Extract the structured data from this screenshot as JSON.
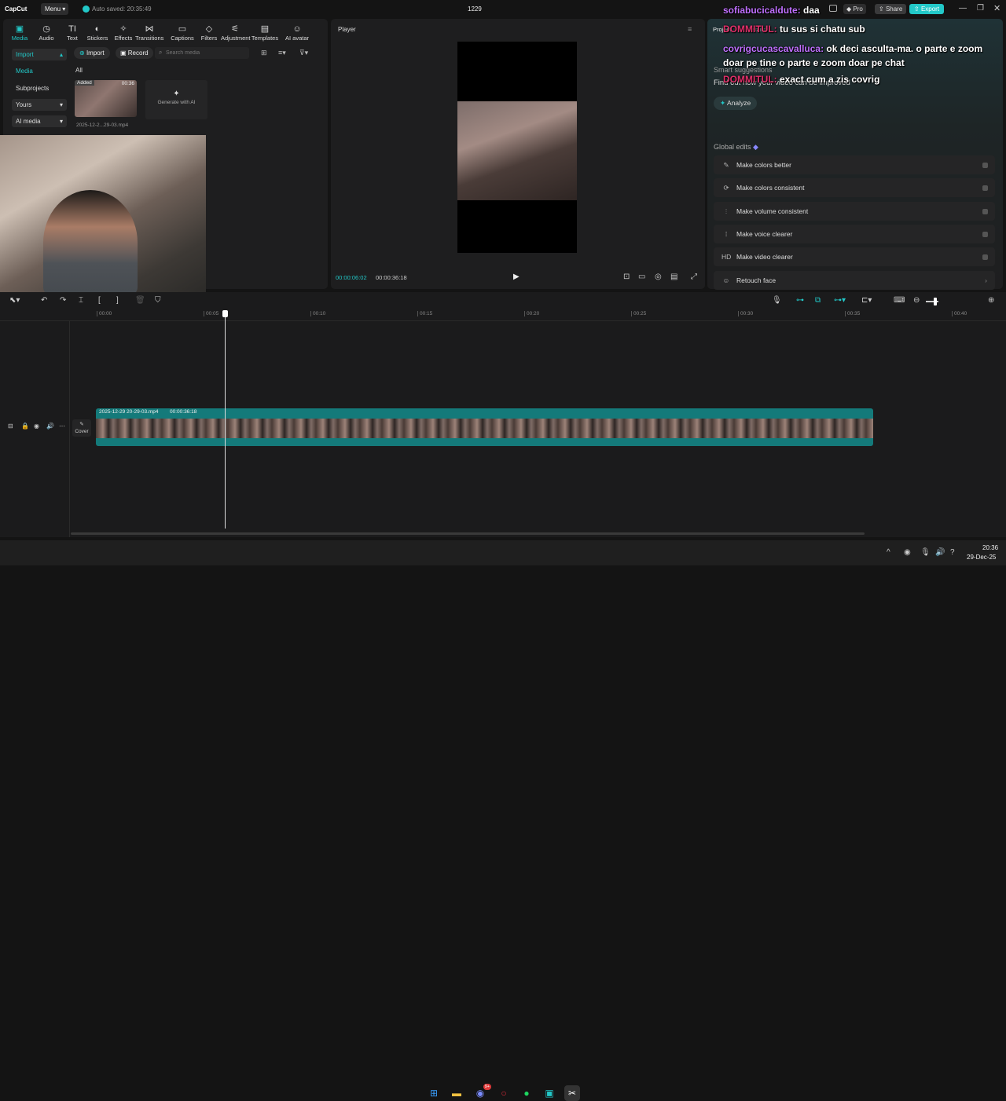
{
  "app": {
    "logo": "CapCut",
    "menu": "Menu",
    "autosave": "Auto saved: 20:35:49",
    "title": "1229"
  },
  "top_right": {
    "pro": "Pro",
    "share": "Share",
    "export": "Export"
  },
  "toolbar": [
    {
      "label": "Media",
      "icon": "media-icon",
      "active": true
    },
    {
      "label": "Audio",
      "icon": "audio-icon"
    },
    {
      "label": "Text",
      "icon": "text-icon"
    },
    {
      "label": "Stickers",
      "icon": "stickers-icon"
    },
    {
      "label": "Effects",
      "icon": "effects-icon"
    },
    {
      "label": "Transitions",
      "icon": "transitions-icon"
    },
    {
      "label": "Captions",
      "icon": "captions-icon"
    },
    {
      "label": "Filters",
      "icon": "filters-icon"
    },
    {
      "label": "Adjustment",
      "icon": "adjustment-icon"
    },
    {
      "label": "Templates",
      "icon": "templates-icon"
    },
    {
      "label": "AI avatar",
      "icon": "ai-avatar-icon"
    }
  ],
  "sidebar": {
    "import": "Import",
    "media": "Media",
    "subprojects": "Subprojects",
    "yours": "Yours",
    "ai_media": "AI media"
  },
  "media": {
    "import_btn": "Import",
    "record_btn": "Record",
    "search_placeholder": "Search media",
    "filter_all": "All",
    "clip_badge": "Added",
    "clip_duration": "00:36",
    "clip_name": "2025-12-2...29-03.mp4",
    "generate": "Generate with AI"
  },
  "player": {
    "title": "Player",
    "current_time": "00:00:06:02",
    "total_time": "00:00:36:18"
  },
  "right_panel": {
    "tab_project": "Project",
    "tab_details": "Details",
    "smart_title": "Smart suggestions",
    "smart_desc": "Find out how your video can be improved",
    "analyze": "Analyze",
    "global_title": "Global edits",
    "edits": [
      "Make colors better",
      "Make colors consistent",
      "Make volume consistent",
      "Make voice clearer",
      "Make video clearer",
      "Retouch face"
    ]
  },
  "chat": [
    {
      "name": "sofiabucicaldute:",
      "msg": "daa"
    },
    {
      "name": "DOMMITUL:",
      "msg": "tu sus si chatu sub"
    },
    {
      "name": "covrigcucascavalluca:",
      "msg": "ok deci asculta-ma. o parte e zoom doar pe tine o parte e zoom doar pe chat"
    },
    {
      "name": "DOMMITUL:",
      "msg": "exact cum a zis covrig"
    }
  ],
  "timeline": {
    "ticks": [
      "00:00",
      "00:05",
      "00:10",
      "00:15",
      "00:20",
      "00:25",
      "00:30",
      "00:35",
      "00:40"
    ],
    "clip_name": "2025-12-29 20-29-03.mp4",
    "clip_duration": "00:00:36:18",
    "cover": "Cover"
  },
  "taskbar": {
    "time": "20:36",
    "date": "29-Dec-25",
    "discord_badge": "9+"
  },
  "colors": {
    "accent": "#22c8c8",
    "chat_name": "#c070ff"
  }
}
